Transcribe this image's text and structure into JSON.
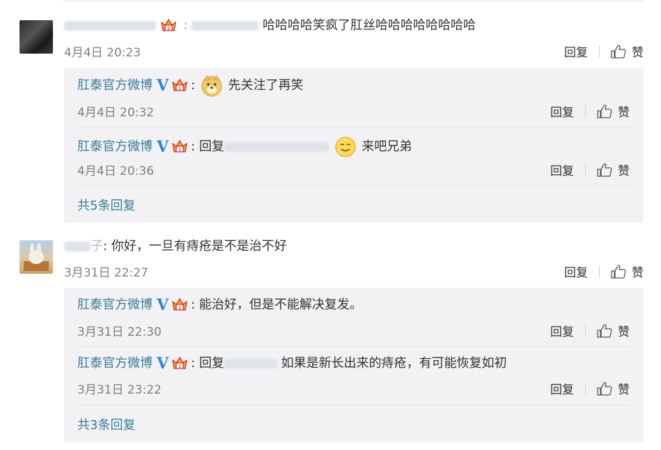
{
  "comments": [
    {
      "time": "4月4日 20:23",
      "content_tail": "哈哈哈哈笑疯了肛丝哈哈哈哈哈哈哈哈",
      "reply_label": "回复",
      "like_label": "赞",
      "replies": [
        {
          "author": "肛泰官方微博",
          "text": "先关注了再笑",
          "time": "4月4日 20:32",
          "reply_label": "回复",
          "like_label": "赞"
        },
        {
          "author": "肛泰官方微博",
          "prefix": "回复",
          "text": "来吧兄弟",
          "time": "4月4日 20:36",
          "reply_label": "回复",
          "like_label": "赞"
        }
      ],
      "more": "共5条回复"
    },
    {
      "name_tail": "子",
      "content": "你好，一旦有痔疮是不是治不好",
      "time": "3月31日 22:27",
      "reply_label": "回复",
      "like_label": "赞",
      "replies": [
        {
          "author": "肛泰官方微博",
          "text": "能治好，但是不能解决复发。",
          "time": "3月31日 22:30",
          "reply_label": "回复",
          "like_label": "赞"
        },
        {
          "author": "肛泰官方微博",
          "prefix": "回复",
          "text": "如果是新长出来的痔疮，有可能恢复如初",
          "time": "3月31日 23:22",
          "reply_label": "回复",
          "like_label": "赞"
        }
      ],
      "more": "共3条回复"
    }
  ],
  "colors": {
    "link": "#3b7a96",
    "reply_bg": "#f2f2f5",
    "vip_badge": "#2f86d6"
  },
  "icons": [
    "thumb-up-icon",
    "verified-v-icon",
    "vip-crown-icon",
    "doge-emoji-icon",
    "smile-emoji-icon"
  ]
}
